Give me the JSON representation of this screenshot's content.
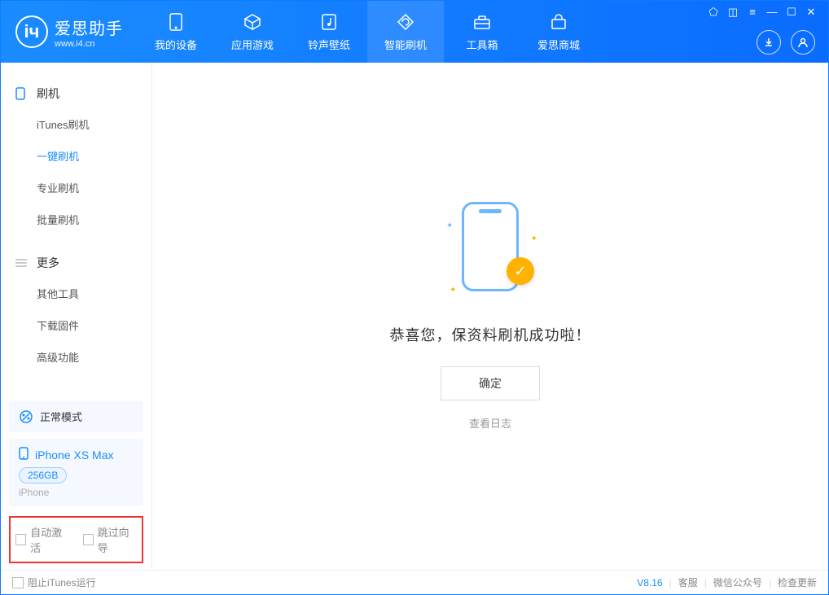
{
  "app": {
    "title": "爱思助手",
    "url": "www.i4.cn"
  },
  "tabs": [
    {
      "label": "我的设备",
      "icon": "device-icon"
    },
    {
      "label": "应用游戏",
      "icon": "cube-icon"
    },
    {
      "label": "铃声壁纸",
      "icon": "music-icon"
    },
    {
      "label": "智能刷机",
      "icon": "refresh-icon",
      "active": true
    },
    {
      "label": "工具箱",
      "icon": "toolbox-icon"
    },
    {
      "label": "爱思商城",
      "icon": "shop-icon"
    }
  ],
  "sidebar": {
    "group1_title": "刷机",
    "group1_items": [
      {
        "label": "iTunes刷机"
      },
      {
        "label": "一键刷机",
        "active": true
      },
      {
        "label": "专业刷机"
      },
      {
        "label": "批量刷机"
      }
    ],
    "group2_title": "更多",
    "group2_items": [
      {
        "label": "其他工具"
      },
      {
        "label": "下载固件"
      },
      {
        "label": "高级功能"
      }
    ]
  },
  "device_status": {
    "label": "正常模式"
  },
  "device": {
    "name": "iPhone XS Max",
    "capacity": "256GB",
    "type": "iPhone"
  },
  "checks": {
    "auto_activate": "自动激活",
    "skip_guide": "跳过向导"
  },
  "result": {
    "message": "恭喜您，保资料刷机成功啦！",
    "ok": "确定",
    "view_log": "查看日志"
  },
  "footer": {
    "block_itunes": "阻止iTunes运行",
    "version": "V8.16",
    "links": [
      "客服",
      "微信公众号",
      "检查更新"
    ]
  }
}
